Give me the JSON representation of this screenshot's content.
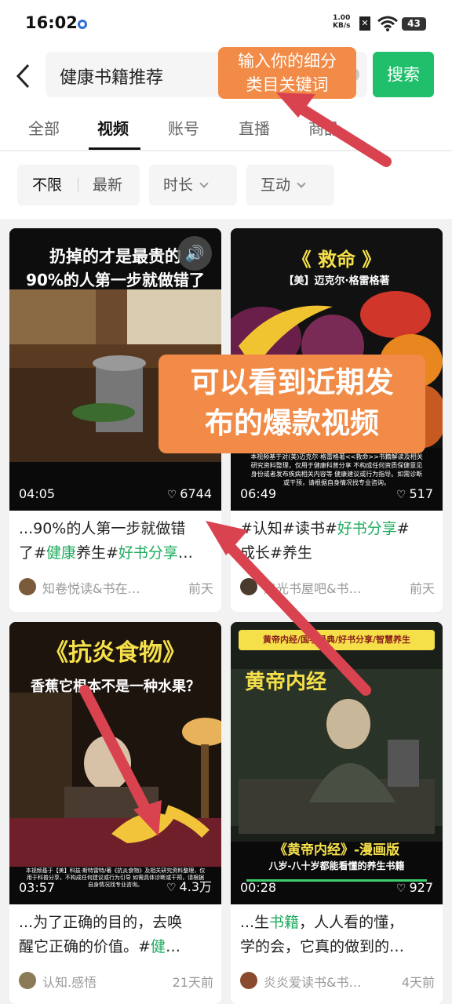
{
  "status": {
    "time": "16:02",
    "net_speed": "1.00",
    "net_unit": "KB/s",
    "battery": "43"
  },
  "header": {
    "query": "健康书籍推荐",
    "search_label": "搜索"
  },
  "tip_top": {
    "line1": "输入你的细分",
    "line2": "类目关键词"
  },
  "tabs": [
    "全部",
    "视频",
    "账号",
    "直播",
    "商品"
  ],
  "filters": {
    "sort_options": [
      "不限",
      "最新"
    ],
    "duration_label": "时长",
    "interaction_label": "互动"
  },
  "tip_mid": {
    "line1": "可以看到近期发",
    "line2": "布的爆款视频"
  },
  "cards": [
    {
      "overlay_line1": "扔掉的才是最贵的",
      "overlay_line2": "90%的人第一步就做错了",
      "duration": "04:05",
      "likes": "6744",
      "desc_a": "...90%的人第一步就做错",
      "desc_b": "了#",
      "desc_hl1": "健康",
      "desc_c": "养生#",
      "desc_hl2": "好书分享",
      "desc_d": "…",
      "author": "知卷悦读&书在…",
      "time": "前天"
    },
    {
      "overlay_line1": "《 救命 》",
      "overlay_line2": "【美】迈克尔·格雷格著",
      "fine_print": "本视频基于对(美)迈克尔·格雷格著<<救命>>书籍解读及相关研究资料整理，仅用于健康科普分享 不构成任何资质保健意见身份或者发布疾病相关内容等 健康建议或行为指导。如需诊断或干预，请根据自身情况找专业咨询。",
      "duration": "06:49",
      "likes": "517",
      "desc_a": "#认知#读书#",
      "desc_hl1": "好书分享",
      "desc_b": "#",
      "desc_c": "成长#养生",
      "author": "追光书屋吧&书…",
      "time": "前天"
    },
    {
      "overlay_line1": "《抗炎食物》",
      "overlay_line2": "香蕉它根本不是一种水果？",
      "fine_print": "本视频基于【美】科兹·斯特雷特/著《抗炎食物》及相关研究资料整理，仅用于科普分享，不构成任何建议或行为引导 如需具体诊断或干预，请根据自身情况找专业咨询。",
      "duration": "03:57",
      "likes": "4.3万",
      "desc_a": "...为了正确的目的，去唤",
      "desc_b": "醒它正确的价值。#",
      "desc_hl1": "健",
      "desc_c": "…",
      "author": "认知.感悟",
      "time": "21天前"
    },
    {
      "banner": "黄帝内经/国学经典/好书分享/智慧养生",
      "overlay_line1": "黄帝内经",
      "overlay_line2": "《黄帝内经》-漫画版",
      "overlay_line3": "八岁-八十岁都能看懂的养生书籍",
      "duration": "00:28",
      "likes": "927",
      "desc_a": "...生",
      "desc_hl1": "书籍",
      "desc_b": "，人人看的懂，",
      "desc_c": "学的会，它真的做到的…",
      "author": "炎炎爱读书&书…",
      "time": "4天前"
    }
  ],
  "colors": {
    "accent_green": "#1fbf6b",
    "tip_orange": "#f18b47",
    "arrow_red": "#d9434f"
  }
}
